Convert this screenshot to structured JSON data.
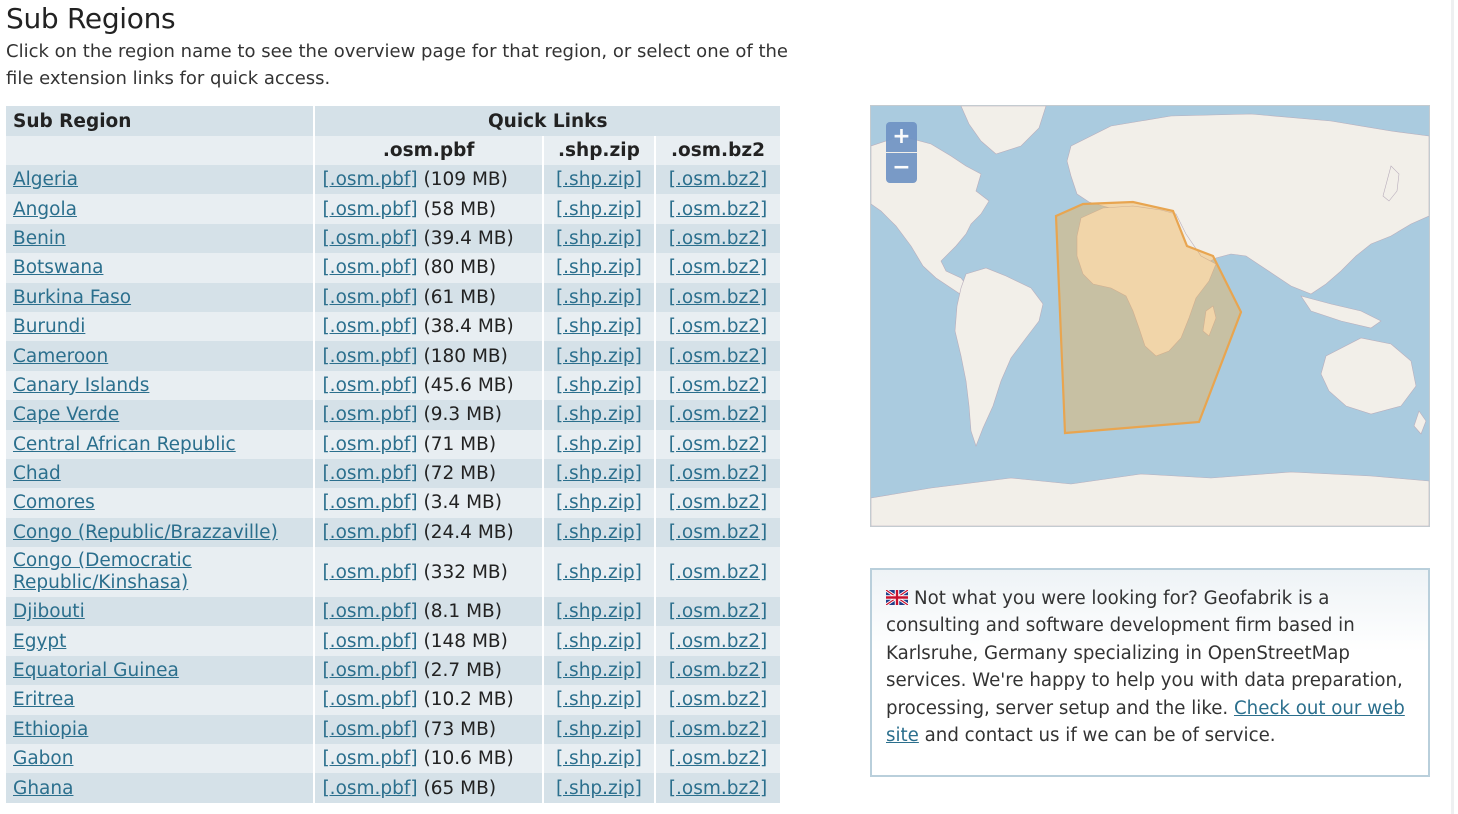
{
  "page": {
    "title": "Sub Regions",
    "intro": "Click on the region name to see the overview page for that region, or select one of the file extension links for quick access."
  },
  "table": {
    "header_region": "Sub Region",
    "header_quick_links": "Quick Links",
    "col_pbf": ".osm.pbf",
    "col_shp": ".shp.zip",
    "col_bz2": ".osm.bz2",
    "link_pbf": "[.osm.pbf]",
    "link_shp": "[.shp.zip]",
    "link_bz2": "[.osm.bz2]",
    "rows": [
      {
        "name": "Algeria",
        "size": "(109 MB)"
      },
      {
        "name": "Angola",
        "size": "(58 MB)"
      },
      {
        "name": "Benin",
        "size": "(39.4 MB)"
      },
      {
        "name": "Botswana",
        "size": "(80 MB)"
      },
      {
        "name": "Burkina Faso",
        "size": "(61 MB)"
      },
      {
        "name": "Burundi",
        "size": "(38.4 MB)"
      },
      {
        "name": "Cameroon",
        "size": "(180 MB)"
      },
      {
        "name": "Canary Islands",
        "size": "(45.6 MB)"
      },
      {
        "name": "Cape Verde",
        "size": "(9.3 MB)"
      },
      {
        "name": "Central African Republic",
        "size": "(71 MB)"
      },
      {
        "name": "Chad",
        "size": "(72 MB)"
      },
      {
        "name": "Comores",
        "size": "(3.4 MB)"
      },
      {
        "name": "Congo (Republic/Brazzaville)",
        "size": "(24.4 MB)"
      },
      {
        "name": "Congo (Democratic Republic/Kinshasa)",
        "size": "(332 MB)"
      },
      {
        "name": "Djibouti",
        "size": "(8.1 MB)"
      },
      {
        "name": "Egypt",
        "size": "(148 MB)"
      },
      {
        "name": "Equatorial Guinea",
        "size": "(2.7 MB)"
      },
      {
        "name": "Eritrea",
        "size": "(10.2 MB)"
      },
      {
        "name": "Ethiopia",
        "size": "(73 MB)"
      },
      {
        "name": "Gabon",
        "size": "(10.6 MB)"
      },
      {
        "name": "Ghana",
        "size": "(65 MB)"
      }
    ]
  },
  "map": {
    "zoom_in": "+",
    "zoom_out": "−",
    "water_color": "#aacbdf",
    "land_color": "#f2efe9",
    "highlight_color": "#f0b050"
  },
  "info": {
    "text_before": "Not what you were looking for? Geofabrik is a consulting and software development firm based in Karlsruhe, Germany specializing in OpenStreetMap services. We're happy to help you with data preparation, processing, server setup and the like.",
    "link_text": "Check out our web site",
    "text_after": "and contact us if we can be of service.",
    "flag_icon": "uk-flag-icon"
  }
}
